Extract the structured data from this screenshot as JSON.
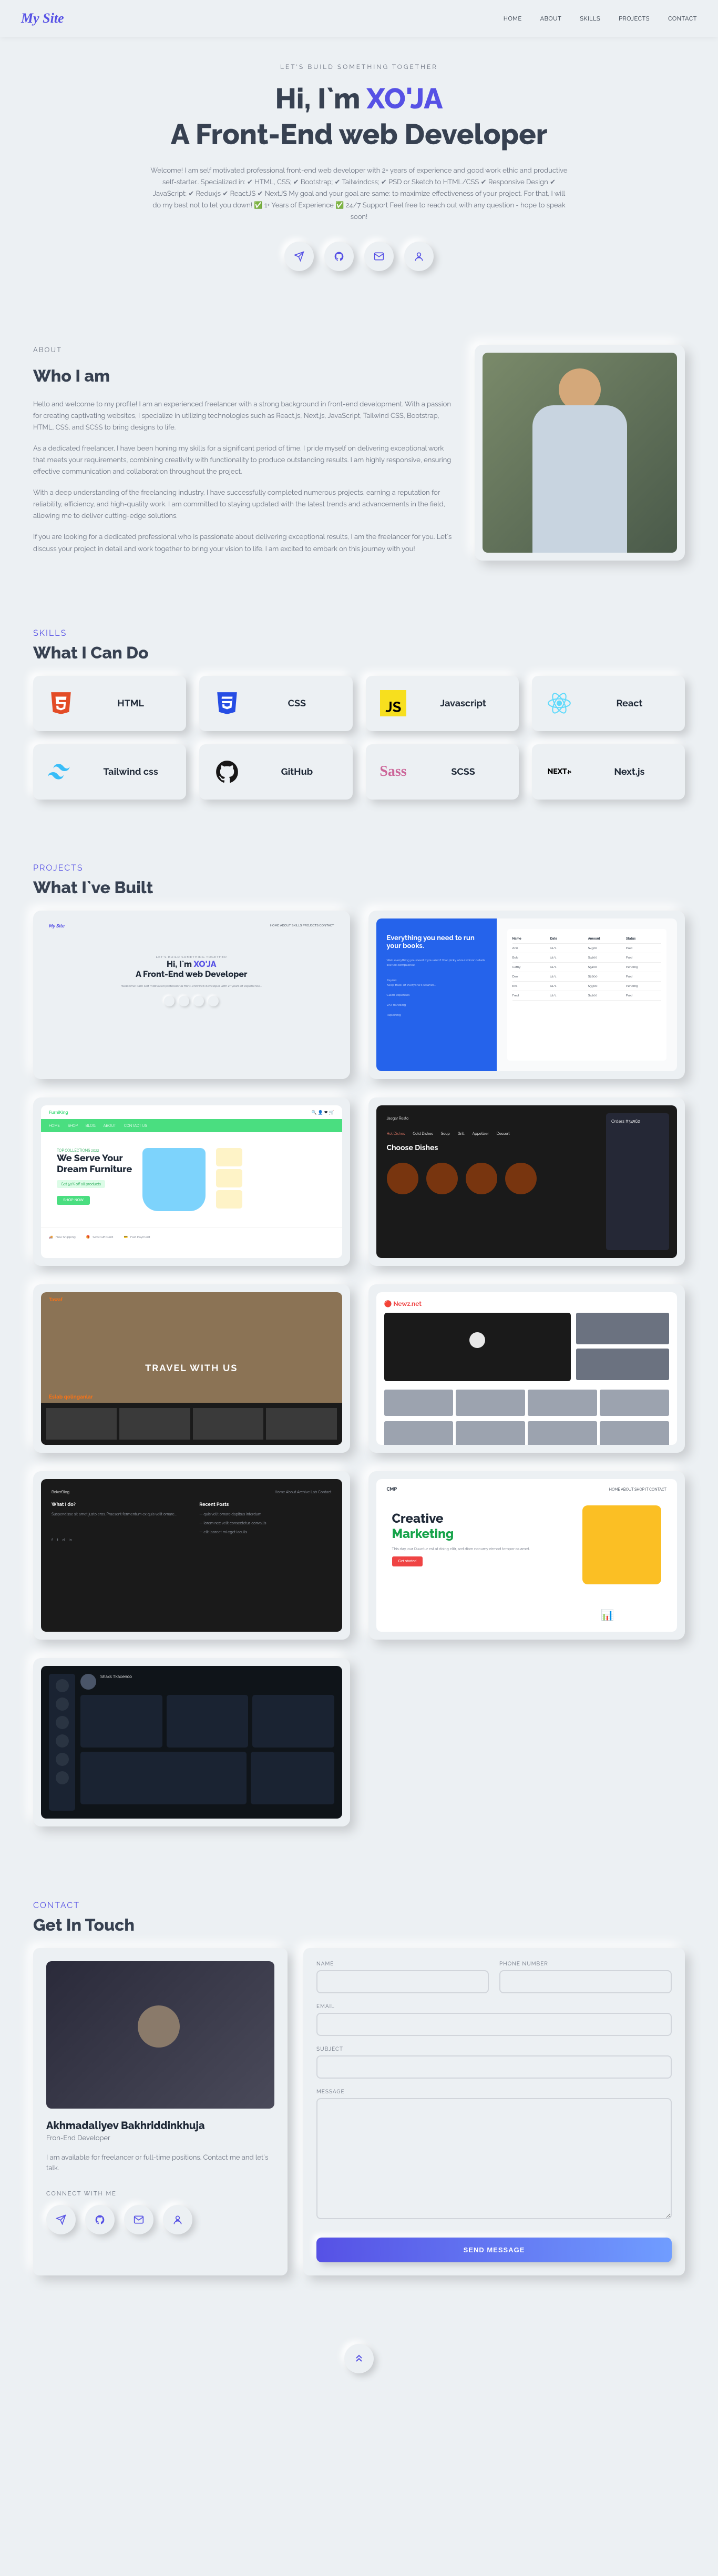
{
  "site": {
    "logo": "My Site"
  },
  "nav": [
    "HOME",
    "ABOUT",
    "SKILLS",
    "PROJECTS",
    "CONTACT"
  ],
  "hero": {
    "tagline": "LET'S BUILD SOMETHING TOGETHER",
    "greeting_prefix": "Hi, I`m ",
    "name": "XO'JA",
    "subtitle": "A Front-End web Developer",
    "description": "Welcome! I am self motivated professional front-end web developer with 2+ years of experience and good work ethic and productive self-starter.. Specialized in: ✔ HTML, CSS; ✔ Bootstrap; ✔ Tailwindcss; ✔ PSD or Sketch to HTML/CSS ✔ Responsive Design ✔ JavaScript; ✔ Reduxjs ✔ ReactJS ✔ NextJS My goal and your goal are same: to maximize effectiveness of your project. For that, I will do my best not to let you down! ✅ 1+ Years of Experience ✅ 24/7 Support Feel free to reach out with any question - hope to speak soon!"
  },
  "about": {
    "label": "ABOUT",
    "title": "Who I am",
    "p1": "Hello and welcome to my profile! I am an experienced freelancer with a strong background in front-end development. With a passion for creating captivating websites, I specialize in utilizing technologies such as React.js, Next.js, JavaScript, Tailwind CSS, Bootstrap, HTML, CSS, and SCSS to bring designs to life.",
    "p2": "As a dedicated freelancer, I have been honing my skills for a significant period of time. I pride myself on delivering exceptional work that meets your requirements, combining creativity with functionality to produce outstanding results. I am highly responsive, ensuring effective communication and collaboration throughout the project.",
    "p3": "With a deep understanding of the freelancing industry, I have successfully completed numerous projects, earning a reputation for reliability, efficiency, and high-quality work. I am committed to staying updated with the latest trends and advancements in the field, allowing me to deliver cutting-edge solutions.",
    "p4": "If you are looking for a dedicated professional who is passionate about delivering exceptional results, I am the freelancer for you. Let`s discuss your project in detail and work together to bring your vision to life. I am excited to embark on this journey with you!"
  },
  "skills": {
    "label": "SKILLS",
    "title": "What I Can Do",
    "items": [
      {
        "name": "HTML",
        "color": "#e34c26"
      },
      {
        "name": "CSS",
        "color": "#264de4"
      },
      {
        "name": "Javascript",
        "color": "#f7df1e"
      },
      {
        "name": "React",
        "color": "#61dafb"
      },
      {
        "name": "Tailwind css",
        "color": "#38bdf8"
      },
      {
        "name": "GitHub",
        "color": "#181717"
      },
      {
        "name": "SCSS",
        "color": "#cc6699"
      },
      {
        "name": "Next.js",
        "color": "#000000"
      }
    ]
  },
  "projects": {
    "label": "PROJECTS",
    "title": "What I`ve Built",
    "thumbs": {
      "portfolio_mini_logo": "My Site",
      "portfolio_h_pre": "Hi, I`m ",
      "portfolio_h_name": "XO'JA",
      "portfolio_h_sub": "A Front-End web Developer",
      "books_title": "Everything you need to run your books.",
      "furn_logo": "FurniKing",
      "furn_label": "TOP COLLECTIONS 2022",
      "furn_h1": "We Serve Your",
      "furn_h2": "Dream Furniture",
      "furn_badge": "Get 50% off all products",
      "furn_f1": "Free Shipping",
      "furn_f2": "Save Gift Card",
      "furn_f3": "Fast Payment",
      "resto_logo": "Jaegar Resto",
      "resto_h": "Choose Dishes",
      "travel_h": "TRAVEL WITH US",
      "travel_label": "Eslab qolinganlar",
      "news_logo": "🔴 Newz.net",
      "blog_logo": "BokerBlog",
      "blog_h": "What I do?",
      "blog_h2": "Recent Posts",
      "mkt_label": "CMP",
      "mkt_h1": "Creative",
      "mkt_h2": "Marketing",
      "mkt_btn": "Get started",
      "dash_name": "Shaxs Tkacenco"
    }
  },
  "contact": {
    "label": "CONTACT",
    "title": "Get In Touch",
    "name": "Akhmadaliyev Bakhriddinkhuja",
    "role": "Fron-End Developer",
    "desc": "I am available for freelancer or full-time positions. Contact me and let`s talk.",
    "connect": "CONNECT WITH ME",
    "form": {
      "name_label": "NAME",
      "phone_label": "PHONE NUMBER",
      "email_label": "EMAIL",
      "subject_label": "SUBJECT",
      "message_label": "MESSAGE",
      "submit": "SEND MESSAGE"
    }
  }
}
